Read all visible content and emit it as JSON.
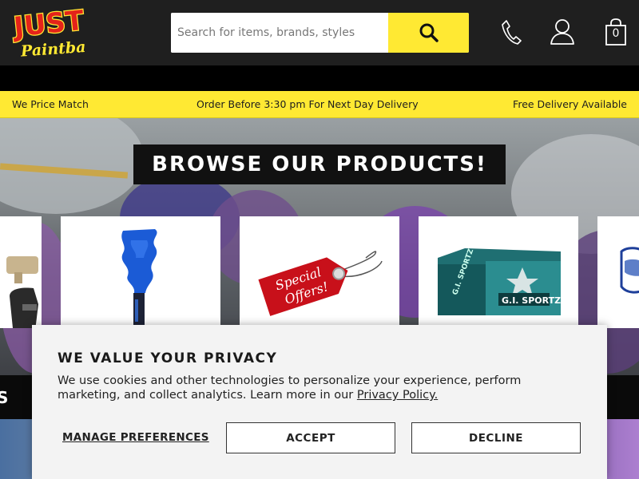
{
  "header": {
    "logo_text_top": "JUST",
    "logo_text_bottom": "Paintball",
    "search_placeholder": "Search for items, brands, styles",
    "bag_count": "0"
  },
  "promo_bar": {
    "left": "We Price Match",
    "center": "Order Before 3:30 pm For Next Day Delivery",
    "right": "Free Delivery Available"
  },
  "hero": {
    "title": "BROWSE OUR PRODUCTS!",
    "special_offers_line1": "Special",
    "special_offers_line2": "Offers!",
    "paint_box_brand": "G.I. SPORTZ"
  },
  "band_text": "S",
  "cookie": {
    "title": "WE VALUE YOUR PRIVACY",
    "body": "We use cookies and other technologies to personalize your experience, perform marketing, and collect analytics. Learn more in our ",
    "link": "Privacy Policy.",
    "manage": "MANAGE PREFERENCES",
    "accept": "ACCEPT",
    "decline": "DECLINE"
  },
  "colors": {
    "header_bg": "#1f1f1f",
    "accent_yellow": "#ffe933",
    "logo_red": "#e4231a"
  }
}
